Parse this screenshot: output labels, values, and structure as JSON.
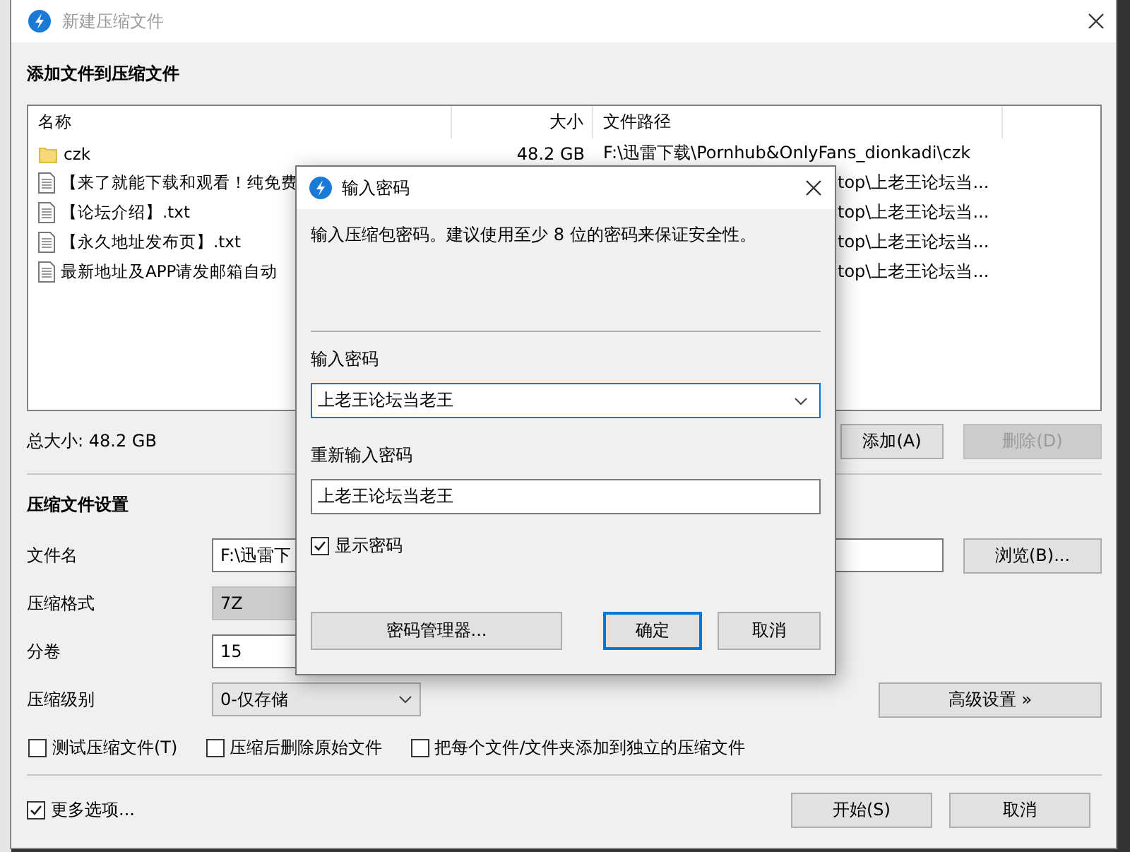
{
  "main_window": {
    "title": "新建压缩文件",
    "section_title": "添加文件到压缩文件",
    "file_list": {
      "columns": [
        "名称",
        "大小",
        "文件路径"
      ],
      "rows": [
        {
          "kind": "folder",
          "covered": false,
          "name": "czk",
          "size": "48.2 GB",
          "path": "F:\\迅雷下载\\Pornhub&OnlyFans_dionkadi\\czk"
        },
        {
          "kind": "file",
          "covered": true,
          "name": "【来了就能下载和观看！纯免费",
          "path": "top\\上老王论坛当..."
        },
        {
          "kind": "file",
          "covered": true,
          "name": "【论坛介绍】.txt",
          "path": "top\\上老王论坛当..."
        },
        {
          "kind": "file",
          "covered": true,
          "name": "【永久地址发布页】.txt",
          "path": "top\\上老王论坛当..."
        },
        {
          "kind": "file",
          "covered": true,
          "name": "最新地址及APP请发邮箱自动",
          "path": "top\\上老王论坛当..."
        }
      ]
    },
    "total_size": "总大小: 48.2 GB",
    "list_buttons": [
      {
        "label": "添加(A)",
        "disabled": false
      },
      {
        "label": "删除(D)",
        "disabled": true
      }
    ],
    "settings_title": "压缩文件设置",
    "fields": [
      {
        "kind": "text",
        "label": "文件名",
        "value": "F:\\迅雷下",
        "disabled": false
      },
      {
        "kind": "select",
        "label": "压缩格式",
        "value": "7Z",
        "disabled": true
      },
      {
        "kind": "text",
        "label": "分卷",
        "value": "15",
        "disabled": false
      },
      {
        "kind": "select",
        "label": "压缩级别",
        "value": "0-仅存储",
        "disabled": false
      }
    ],
    "browse_button": "浏览(B)...",
    "advanced_button": "高级设置 »",
    "options": [
      {
        "label": "测试压缩文件(T)",
        "checked": false
      },
      {
        "label": "压缩后删除原始文件",
        "checked": false
      },
      {
        "label": "把每个文件/文件夹添加到独立的压缩文件",
        "checked": false
      }
    ],
    "more_options": {
      "label": "更多选项...",
      "checked": true
    },
    "start_button": "开始(S)",
    "cancel_button": "取消"
  },
  "password_dialog": {
    "title": "输入密码",
    "hint": "输入压缩包密码。建议使用至少 8 位的密码来保证安全性。",
    "password_label": "输入密码",
    "password": "上老王论坛当老王",
    "confirm_label": "重新输入密码",
    "confirm": "上老王论坛当老王",
    "show_password": {
      "label": "显示密码",
      "checked": true
    },
    "buttons": [
      {
        "label": "密码管理器...",
        "default": false
      },
      {
        "label": "确定",
        "default": true
      },
      {
        "label": "取消",
        "default": false
      }
    ]
  }
}
